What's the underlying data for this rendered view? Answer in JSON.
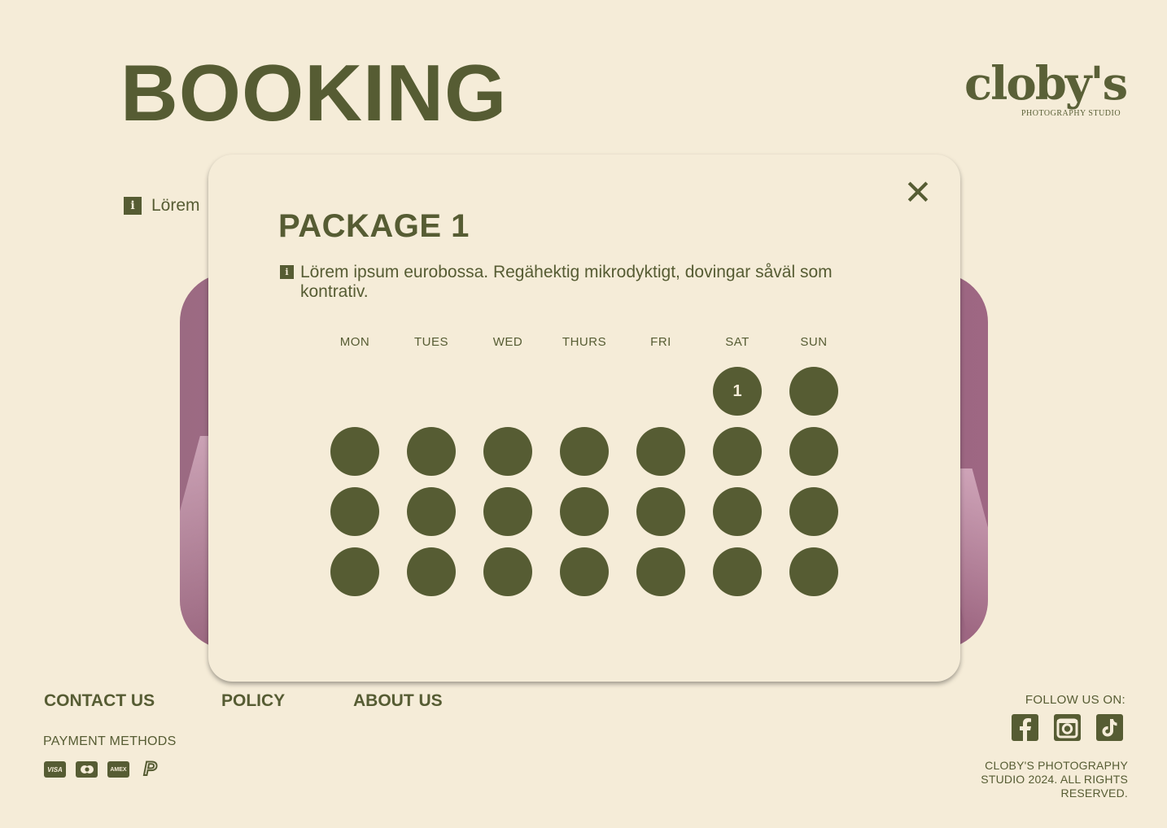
{
  "page": {
    "title": "BOOKING"
  },
  "logo": {
    "wordmark": "cloby's",
    "subtitle": "PHOTOGRAPHY STUDIO"
  },
  "background_info": {
    "text": "Lörem"
  },
  "modal": {
    "title": "PACKAGE 1",
    "info_text": "Lörem ipsum eurobossa. Regähektig mikrodyktigt, dovingar såväl som kontrativ.",
    "close_icon": "close-icon",
    "calendar": {
      "day_headers": [
        "MON",
        "TUES",
        "WED",
        "THURS",
        "FRI",
        "SAT",
        "SUN"
      ],
      "weeks": [
        [
          null,
          null,
          null,
          null,
          null,
          "1",
          ""
        ],
        [
          "",
          "",
          "",
          "",
          "",
          "",
          ""
        ],
        [
          "",
          "",
          "",
          "",
          "",
          "",
          ""
        ],
        [
          "",
          "",
          "",
          "",
          "",
          "",
          ""
        ]
      ]
    }
  },
  "footer": {
    "links": [
      "CONTACT US",
      "POLICY",
      "ABOUT US"
    ],
    "payment_label": "PAYMENT METHODS",
    "payment_icons": [
      {
        "name": "visa-icon",
        "label": "VISA"
      },
      {
        "name": "mastercard-icon",
        "label": ""
      },
      {
        "name": "amex-icon",
        "label": "AMEX"
      },
      {
        "name": "paypal-icon",
        "label": "P"
      }
    ],
    "follow_label": "FOLLOW US ON:",
    "social_icons": [
      "facebook-icon",
      "instagram-icon",
      "tiktok-icon"
    ],
    "copyright": "CLOBY'S PHOTOGRAPHY STUDIO 2024. ALL RIGHTS RESERVED."
  },
  "colors": {
    "primary": "#565c33",
    "background": "#f5ecd8",
    "photo_pink": "#9b6a82"
  }
}
